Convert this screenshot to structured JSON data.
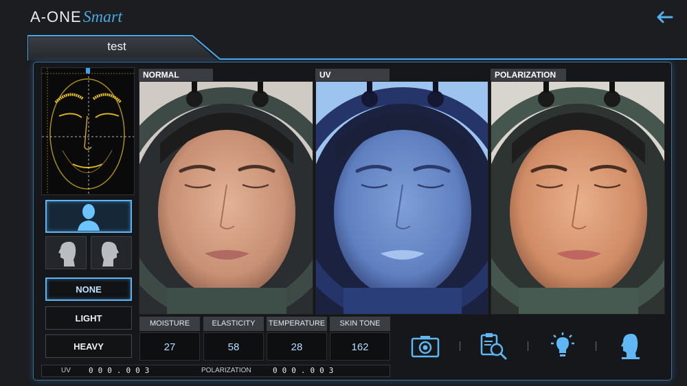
{
  "app": {
    "logo_main": "A-ONE",
    "logo_script": "Smart",
    "session_title": "test",
    "back_icon": "arrow-left-icon"
  },
  "left_panel": {
    "scan_view": "face-scan-thumbnail",
    "profiles": [
      {
        "name": "front",
        "icon": "front-head-icon",
        "active": true
      },
      {
        "name": "left",
        "icon": "left-profile-icon",
        "active": false
      },
      {
        "name": "right",
        "icon": "right-profile-icon",
        "active": false
      }
    ],
    "modes": [
      {
        "label": "NONE",
        "active": true
      },
      {
        "label": "LIGHT",
        "active": false
      },
      {
        "label": "HEAVY",
        "active": false
      }
    ]
  },
  "photos": [
    {
      "label": "NORMAL"
    },
    {
      "label": "UV"
    },
    {
      "label": "POLARIZATION"
    }
  ],
  "metrics": [
    {
      "label": "MOISTURE",
      "value": "27"
    },
    {
      "label": "ELASTICITY",
      "value": "58"
    },
    {
      "label": "TEMPERATURE",
      "value": "28"
    },
    {
      "label": "SKIN TONE",
      "value": "162"
    }
  ],
  "tools": [
    {
      "name": "camera",
      "icon": "camera-icon"
    },
    {
      "name": "analyze",
      "icon": "clipboard-search-icon"
    },
    {
      "name": "light",
      "icon": "bulb-icon"
    },
    {
      "name": "profile",
      "icon": "head-profile-icon"
    }
  ],
  "status": {
    "uv_label": "UV",
    "uv_counter": "000.003",
    "pol_label": "POLARIZATION",
    "pol_counter": "000.003"
  },
  "colors": {
    "accent": "#5fb4f2",
    "background": "#1b1d20",
    "scan_yellow": "#e8c21a"
  }
}
